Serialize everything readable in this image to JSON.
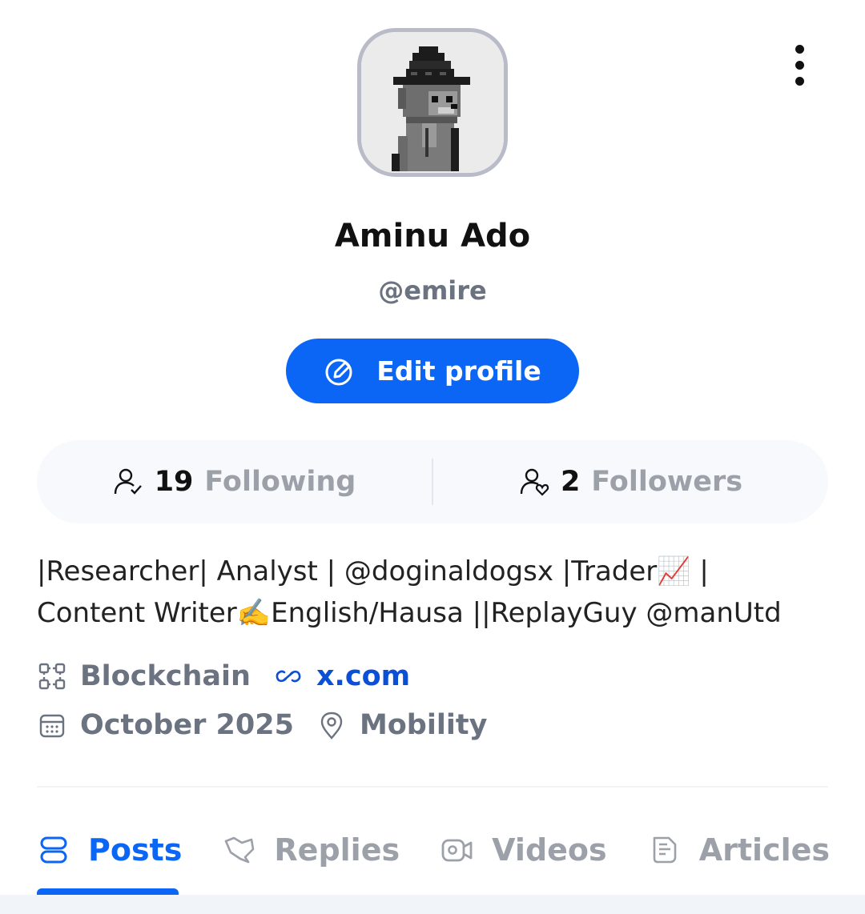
{
  "profile": {
    "display_name": "Aminu Ado",
    "handle": "@emire",
    "avatar_icon": "pixel-wizard-dog-avatar"
  },
  "actions": {
    "edit_profile_label": "Edit profile",
    "more_menu_icon": "more-vertical-icon"
  },
  "stats": {
    "following_count": "19",
    "following_label": "Following",
    "followers_count": "2",
    "followers_label": "Followers"
  },
  "bio": {
    "line1": "|Researcher| Analyst | @doginaldogsx |Trader📈 |",
    "line2": "Content Writer✍️English/Hausa ||ReplayGuy @manUtd"
  },
  "meta": {
    "category": "Blockchain",
    "website": "x.com",
    "joined": "October 2025",
    "location": "Mobility"
  },
  "tabs": [
    {
      "label": "Posts",
      "icon": "posts-icon",
      "active": true
    },
    {
      "label": "Replies",
      "icon": "reply-icon",
      "active": false
    },
    {
      "label": "Videos",
      "icon": "video-icon",
      "active": false
    },
    {
      "label": "Articles",
      "icon": "article-icon",
      "active": false
    }
  ],
  "colors": {
    "accent": "#0b66f5",
    "link": "#0b4fd6",
    "muted": "#6b7280",
    "inactive_tab": "#9ca0a8"
  }
}
